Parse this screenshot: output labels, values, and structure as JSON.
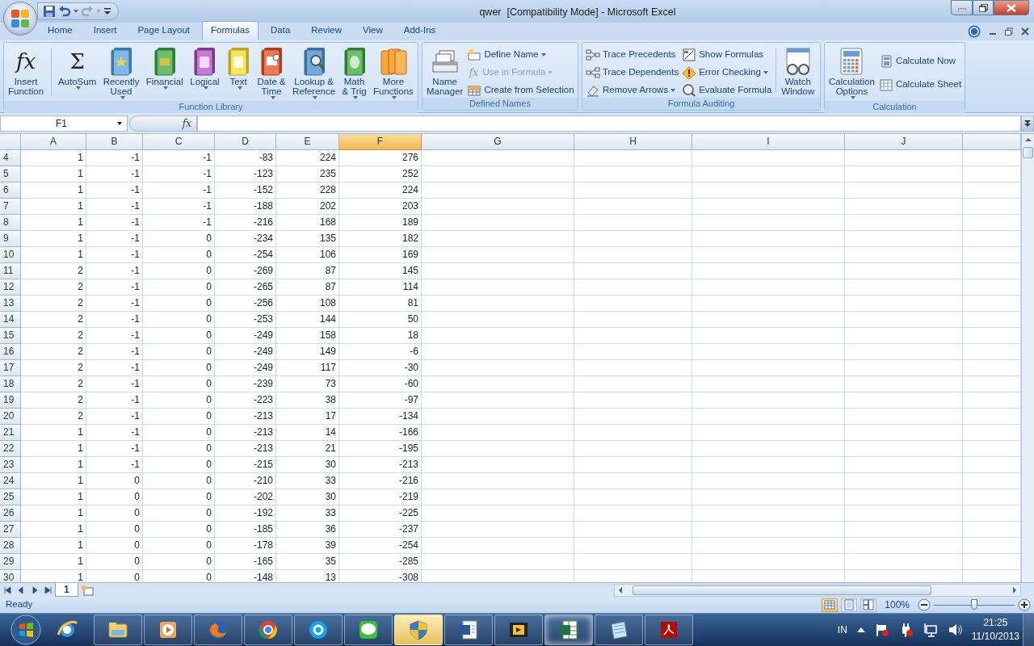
{
  "window": {
    "title": "qwer  [Compatibility Mode] - Microsoft Excel"
  },
  "tabs": [
    {
      "label": "Home",
      "selected": false
    },
    {
      "label": "Insert",
      "selected": false
    },
    {
      "label": "Page Layout",
      "selected": false
    },
    {
      "label": "Formulas",
      "selected": true
    },
    {
      "label": "Data",
      "selected": false
    },
    {
      "label": "Review",
      "selected": false
    },
    {
      "label": "View",
      "selected": false
    },
    {
      "label": "Add-Ins",
      "selected": false
    }
  ],
  "ribbon": [
    {
      "label": "Function Library",
      "columns": [
        {
          "kind": "large",
          "items": [
            {
              "label": [
                "Insert",
                "Function"
              ],
              "glyph": "fx",
              "dropdown": false,
              "disabled": false
            }
          ]
        },
        {
          "kind": "separator"
        },
        {
          "kind": "large",
          "items": [
            {
              "label": [
                "AutoSum"
              ],
              "glyph": "Σ",
              "dropdown": true,
              "disabled": false
            }
          ]
        },
        {
          "kind": "large",
          "items": [
            {
              "label": [
                "Recently",
                "Used"
              ],
              "dropdown": true,
              "disabled": false
            }
          ]
        },
        {
          "kind": "large",
          "items": [
            {
              "label": [
                "Financial"
              ],
              "dropdown": true,
              "disabled": false
            }
          ]
        },
        {
          "kind": "large",
          "items": [
            {
              "label": [
                "Logical"
              ],
              "dropdown": true,
              "disabled": false
            }
          ]
        },
        {
          "kind": "large",
          "items": [
            {
              "label": [
                "Text"
              ],
              "dropdown": true,
              "disabled": false
            }
          ]
        },
        {
          "kind": "large",
          "items": [
            {
              "label": [
                "Date &",
                "Time"
              ],
              "dropdown": true,
              "disabled": false
            }
          ]
        },
        {
          "kind": "large",
          "items": [
            {
              "label": [
                "Lookup &",
                "Reference"
              ],
              "dropdown": true,
              "disabled": false
            }
          ]
        },
        {
          "kind": "large",
          "items": [
            {
              "label": [
                "Math",
                "& Trig"
              ],
              "dropdown": true,
              "disabled": false
            }
          ]
        },
        {
          "kind": "large",
          "items": [
            {
              "label": [
                "More",
                "Functions"
              ],
              "dropdown": true,
              "disabled": false
            }
          ]
        }
      ]
    },
    {
      "label": "Defined Names",
      "columns": [
        {
          "kind": "large",
          "items": [
            {
              "label": [
                "Name",
                "Manager"
              ],
              "dropdown": false,
              "disabled": false
            }
          ]
        },
        {
          "kind": "stack",
          "items": [
            {
              "label": [
                "Define Name"
              ],
              "dropdown": true,
              "disabled": false
            },
            {
              "label": [
                "Use in Formula"
              ],
              "glyph": "fx",
              "dropdown": true,
              "disabled": true
            },
            {
              "label": [
                "Create from Selection"
              ],
              "dropdown": false,
              "disabled": false
            }
          ]
        }
      ]
    },
    {
      "label": "Formula Auditing",
      "columns": [
        {
          "kind": "stack",
          "items": [
            {
              "label": [
                "Trace Precedents"
              ],
              "dropdown": false,
              "disabled": false
            },
            {
              "label": [
                "Trace Dependents"
              ],
              "dropdown": false,
              "disabled": false
            },
            {
              "label": [
                "Remove Arrows"
              ],
              "dropdown": true,
              "disabled": false
            }
          ]
        },
        {
          "kind": "stack",
          "items": [
            {
              "label": [
                "Show Formulas"
              ],
              "dropdown": false,
              "disabled": false
            },
            {
              "label": [
                "Error Checking"
              ],
              "dropdown": true,
              "disabled": false
            },
            {
              "label": [
                "Evaluate Formula"
              ],
              "dropdown": false,
              "disabled": false
            }
          ]
        },
        {
          "kind": "separator"
        },
        {
          "kind": "large",
          "items": [
            {
              "label": [
                "Watch",
                "Window"
              ],
              "dropdown": false,
              "disabled": false
            }
          ]
        }
      ]
    },
    {
      "label": "Calculation",
      "columns": [
        {
          "kind": "large",
          "items": [
            {
              "label": [
                "Calculation",
                "Options"
              ],
              "dropdown": true,
              "disabled": false
            }
          ]
        },
        {
          "kind": "stack",
          "items": [
            {
              "label": [
                "Calculate Now"
              ],
              "dropdown": false,
              "disabled": false
            },
            {
              "label": [
                "Calculate Sheet"
              ],
              "dropdown": false,
              "disabled": false
            }
          ]
        }
      ]
    }
  ],
  "formula_bar": {
    "name_box": "F1",
    "function_glyph": "fx"
  },
  "columns": [
    {
      "label": "A",
      "selected": false
    },
    {
      "label": "B",
      "selected": false
    },
    {
      "label": "C",
      "selected": false
    },
    {
      "label": "D",
      "selected": false
    },
    {
      "label": "E",
      "selected": false
    },
    {
      "label": "F",
      "selected": true
    },
    {
      "label": "G",
      "selected": false
    },
    {
      "label": "H",
      "selected": false
    },
    {
      "label": "I",
      "selected": false
    },
    {
      "label": "J",
      "selected": false
    }
  ],
  "rows": [
    {
      "header": "4",
      "cells": [
        "1",
        "-1",
        "-1",
        "-83",
        "224",
        "276"
      ]
    },
    {
      "header": "5",
      "cells": [
        "1",
        "-1",
        "-1",
        "-123",
        "235",
        "252"
      ]
    },
    {
      "header": "6",
      "cells": [
        "1",
        "-1",
        "-1",
        "-152",
        "228",
        "224"
      ]
    },
    {
      "header": "7",
      "cells": [
        "1",
        "-1",
        "-1",
        "-188",
        "202",
        "203"
      ]
    },
    {
      "header": "8",
      "cells": [
        "1",
        "-1",
        "-1",
        "-216",
        "168",
        "189"
      ]
    },
    {
      "header": "9",
      "cells": [
        "1",
        "-1",
        "0",
        "-234",
        "135",
        "182"
      ]
    },
    {
      "header": "10",
      "cells": [
        "1",
        "-1",
        "0",
        "-254",
        "106",
        "169"
      ]
    },
    {
      "header": "11",
      "cells": [
        "2",
        "-1",
        "0",
        "-269",
        "87",
        "145"
      ]
    },
    {
      "header": "12",
      "cells": [
        "2",
        "-1",
        "0",
        "-265",
        "87",
        "114"
      ]
    },
    {
      "header": "13",
      "cells": [
        "2",
        "-1",
        "0",
        "-256",
        "108",
        "81"
      ]
    },
    {
      "header": "14",
      "cells": [
        "2",
        "-1",
        "0",
        "-253",
        "144",
        "50"
      ]
    },
    {
      "header": "15",
      "cells": [
        "2",
        "-1",
        "0",
        "-249",
        "158",
        "18"
      ]
    },
    {
      "header": "16",
      "cells": [
        "2",
        "-1",
        "0",
        "-249",
        "149",
        "-6"
      ]
    },
    {
      "header": "17",
      "cells": [
        "2",
        "-1",
        "0",
        "-249",
        "117",
        "-30"
      ]
    },
    {
      "header": "18",
      "cells": [
        "2",
        "-1",
        "0",
        "-239",
        "73",
        "-60"
      ]
    },
    {
      "header": "19",
      "cells": [
        "2",
        "-1",
        "0",
        "-223",
        "38",
        "-97"
      ]
    },
    {
      "header": "20",
      "cells": [
        "2",
        "-1",
        "0",
        "-213",
        "17",
        "-134"
      ]
    },
    {
      "header": "21",
      "cells": [
        "1",
        "-1",
        "0",
        "-213",
        "14",
        "-166"
      ]
    },
    {
      "header": "22",
      "cells": [
        "1",
        "-1",
        "0",
        "-213",
        "21",
        "-195"
      ]
    },
    {
      "header": "23",
      "cells": [
        "1",
        "-1",
        "0",
        "-215",
        "30",
        "-213"
      ]
    },
    {
      "header": "24",
      "cells": [
        "1",
        "0",
        "0",
        "-210",
        "33",
        "-216"
      ]
    },
    {
      "header": "25",
      "cells": [
        "1",
        "0",
        "0",
        "-202",
        "30",
        "-219"
      ]
    },
    {
      "header": "26",
      "cells": [
        "1",
        "0",
        "0",
        "-192",
        "33",
        "-225"
      ]
    },
    {
      "header": "27",
      "cells": [
        "1",
        "0",
        "0",
        "-185",
        "36",
        "-237"
      ]
    },
    {
      "header": "28",
      "cells": [
        "1",
        "0",
        "0",
        "-178",
        "39",
        "-254"
      ]
    },
    {
      "header": "29",
      "cells": [
        "1",
        "0",
        "0",
        "-165",
        "35",
        "-285"
      ]
    },
    {
      "header": "30",
      "cells": [
        "1",
        "0",
        "0",
        "-148",
        "13",
        "-308"
      ]
    }
  ],
  "sheet_tabs": [
    {
      "label": "1",
      "selected": true
    }
  ],
  "status_bar": {
    "status": "Ready",
    "views": [
      {
        "selected": true
      },
      {
        "selected": false
      },
      {
        "selected": false
      }
    ],
    "zoom": "100%",
    "zoom_slider": {
      "level": 0.5
    }
  },
  "taskbar": {
    "apps": [
      {
        "running": false,
        "highlighted": false,
        "selected": false
      },
      {
        "running": true,
        "highlighted": false,
        "selected": false
      },
      {
        "running": true,
        "highlighted": false,
        "selected": false
      },
      {
        "running": true,
        "highlighted": false,
        "selected": false
      },
      {
        "running": true,
        "highlighted": false,
        "selected": false
      },
      {
        "running": true,
        "highlighted": false,
        "selected": false
      },
      {
        "running": true,
        "highlighted": false,
        "selected": false
      },
      {
        "running": true,
        "highlighted": true,
        "selected": false
      },
      {
        "running": true,
        "highlighted": false,
        "selected": false
      },
      {
        "running": true,
        "highlighted": false,
        "selected": false
      },
      {
        "running": true,
        "highlighted": false,
        "selected": true
      },
      {
        "running": true,
        "highlighted": false,
        "selected": false
      },
      {
        "running": true,
        "highlighted": false,
        "selected": false
      }
    ],
    "language": "IN",
    "time": "21:25",
    "date": "11/10/2013"
  }
}
